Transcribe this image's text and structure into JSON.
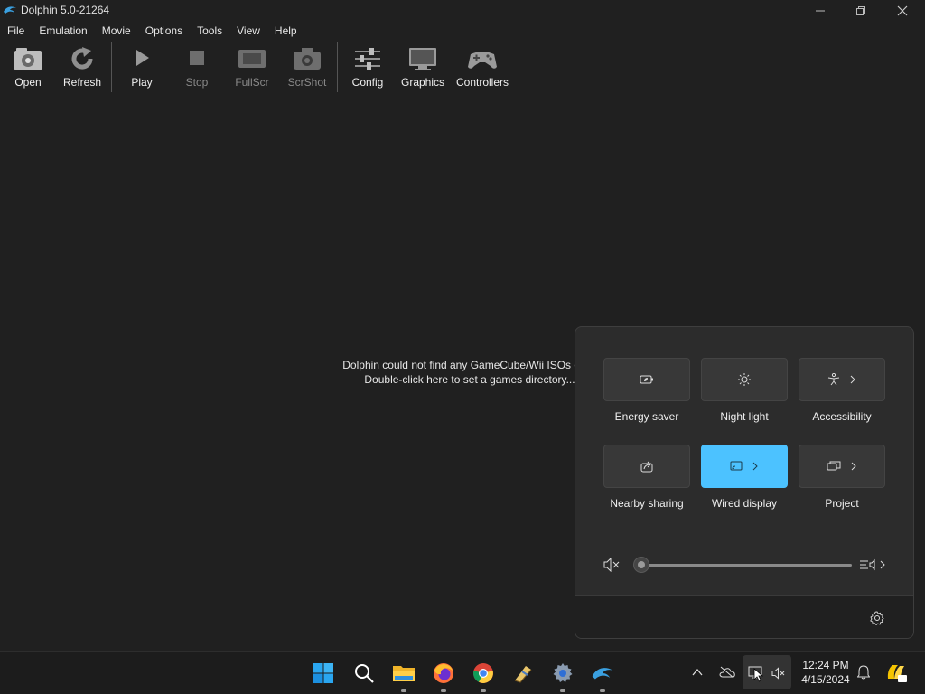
{
  "window": {
    "title": "Dolphin 5.0-21264"
  },
  "menu": [
    "File",
    "Emulation",
    "Movie",
    "Options",
    "Tools",
    "View",
    "Help"
  ],
  "toolbar": {
    "open": "Open",
    "refresh": "Refresh",
    "play": "Play",
    "stop": "Stop",
    "fullscr": "FullScr",
    "scrshot": "ScrShot",
    "config": "Config",
    "graphics": "Graphics",
    "controllers": "Controllers"
  },
  "game_list": {
    "line1": "Dolphin could not find any GameCube/Wii ISOs or W",
    "line2": "Double-click here to set a games directory..."
  },
  "quick_settings": {
    "tiles": {
      "energy_saver": "Energy saver",
      "night_light": "Night light",
      "accessibility": "Accessibility",
      "nearby_sharing": "Nearby sharing",
      "wired_display": "Wired display",
      "project": "Project"
    },
    "volume_level": 0,
    "accent_color": "#4cc2ff"
  },
  "taskbar": {
    "time": "12:24 PM",
    "date": "4/15/2024",
    "apps": [
      "start-icon",
      "search-icon",
      "file-explorer-icon",
      "firefox-icon",
      "chrome-icon",
      "app-icon",
      "settings-icon",
      "dolphin-icon"
    ]
  }
}
